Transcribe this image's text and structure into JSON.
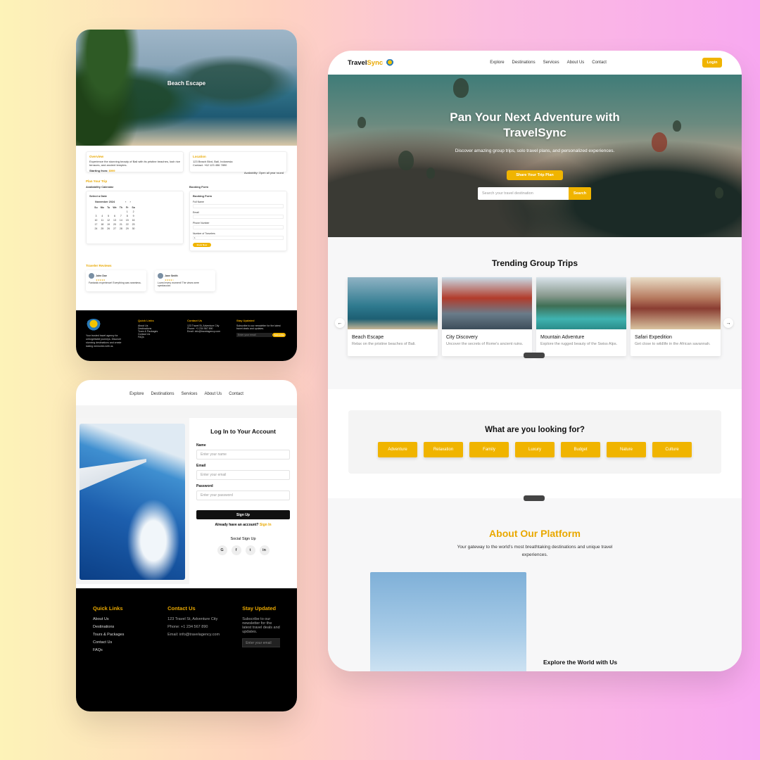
{
  "detail": {
    "hero_title": "Beach Escape",
    "overview_title": "Overview",
    "location_title": "Location",
    "overview_text": "Experience the stunning beauty of Bali with its pristine beaches, lush rice terraces, and ancient temples.",
    "location_text": "123 Beach Blvd, Bali, Indonesia",
    "location_contact": "Contact: +62 123 456 7890",
    "starting_label": "Starting from:",
    "starting_price": "$999",
    "availability_note": "Availability: Open all year round",
    "plan_title": "Plan Your Trip",
    "calendar_title": "Availability Calendar",
    "booking_title": "Booking Form",
    "select_date": "Select a Date",
    "month": "November 2024",
    "weekdays": [
      "Su",
      "Mo",
      "Tu",
      "We",
      "Th",
      "Fr",
      "Sa"
    ],
    "days": [
      "",
      "",
      "",
      "",
      "",
      "1",
      "2",
      "3",
      "4",
      "5",
      "6",
      "7",
      "8",
      "9",
      "10",
      "11",
      "12",
      "13",
      "14",
      "15",
      "16",
      "17",
      "18",
      "19",
      "20",
      "21",
      "22",
      "23",
      "24",
      "25",
      "26",
      "27",
      "28",
      "29",
      "30"
    ],
    "form_heading": "Booking Form",
    "form_fields": [
      "Full Name",
      "Email",
      "Phone Number",
      "Number of Travelers"
    ],
    "travelers_value": "1",
    "book_button": "Book Now",
    "reviews_title": "Traveler Reviews",
    "reviews": [
      {
        "name": "John Doe",
        "stars": "★★★★★",
        "text": "Fantastic experience! Everything was seamless."
      },
      {
        "name": "Jane Smith",
        "stars": "★★★★☆",
        "text": "Loved every moment! The views were spectacular."
      }
    ],
    "footer": {
      "about": "Your trusted travel agency for unforgettable journeys. Discover stunning destinations and create lasting memories with us.",
      "quick_title": "Quick Links",
      "quick": [
        "About Us",
        "Destinations",
        "Tours & Packages",
        "Contact Us",
        "FAQs"
      ],
      "contact_title": "Contact Us",
      "contact": [
        "123 Travel St, Adventure City",
        "Phone: +1 234 567 890",
        "Email: info@travelagency.com"
      ],
      "stay_title": "Stay Updated",
      "stay_text": "Subscribe to our newsletter for the latest travel deals and updates.",
      "email_placeholder": "Enter your email",
      "subscribe": "Subscribe"
    }
  },
  "login": {
    "nav": [
      "Explore",
      "Destinations",
      "Services",
      "About Us",
      "Contact"
    ],
    "title": "Log In to Your Account",
    "name_label": "Name",
    "name_placeholder": "Enter your name",
    "email_label": "Email",
    "email_placeholder": "Enter your email",
    "password_label": "Password",
    "password_placeholder": "Enter your password",
    "signup_button": "Sign Up",
    "already_text": "Already have an account?",
    "signin_link": "Sign In",
    "social_title": "Social Sign Up",
    "social": [
      "G",
      "f",
      "t",
      "in"
    ],
    "footer": {
      "quick_title": "Quick Links",
      "quick": [
        "About Us",
        "Destinations",
        "Tours & Packages",
        "Contact Us",
        "FAQs"
      ],
      "contact_title": "Contact Us",
      "contact": [
        "123 Travel St, Adventure City",
        "Phone: +1 234 567 890",
        "Email: info@travelagency.com"
      ],
      "stay_title": "Stay Updated",
      "stay_text": "Subscribe to our newsletter for the latest travel deals and updates.",
      "email_placeholder": "Enter your email"
    }
  },
  "home": {
    "brand_a": "Travel",
    "brand_b": "Sync",
    "nav": [
      "Explore",
      "Destinations",
      "Services",
      "About Us",
      "Contact"
    ],
    "login": "Login",
    "hero_title": "Pan Your Next Adventure with TravelSync",
    "hero_sub": "Discover amazing group trips, solo travel plans, and personalized experiences.",
    "share_button": "Share Your Trip Plan",
    "search_placeholder": "Search your travel destination",
    "search_button": "Search",
    "trending_title": "Trending Group Trips",
    "trips": [
      {
        "title": "Beach Escape",
        "desc": "Relax on the pristine beaches of Bali."
      },
      {
        "title": "City Discovery",
        "desc": "Uncover the secrets of Rome's ancient ruins."
      },
      {
        "title": "Mountain Adventure",
        "desc": "Explore the rugged beauty of the Swiss Alps."
      },
      {
        "title": "Safari Expedition",
        "desc": "Get close to wildlife in the African savannah."
      }
    ],
    "looking_title": "What are you looking for?",
    "chips": [
      "Adventure",
      "Relaxation",
      "Family",
      "Luxury",
      "Budget",
      "Nature",
      "Culture"
    ],
    "about_title": "About Our Platform",
    "about_text": "Your gateway to the world's most breathtaking destinations and unique travel experiences.",
    "explore_title": "Explore the World with Us"
  },
  "colors": {
    "accent": "#f0b400",
    "dark": "#000000"
  }
}
